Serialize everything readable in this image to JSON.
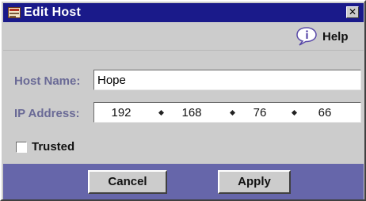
{
  "window": {
    "title": "Edit Host",
    "close_glyph": "✕",
    "app_icon": "dns-host-app-icon"
  },
  "toolbar": {
    "help_label": "Help",
    "help_icon": "info-speech-bubble-icon"
  },
  "form": {
    "host_name_label": "Host Name:",
    "host_name_value": "Hope",
    "ip_address_label": "IP Address:",
    "ip_octets": [
      "192",
      "168",
      "76",
      "66"
    ],
    "trusted_label": "Trusted",
    "trusted_checked": false
  },
  "buttons": {
    "cancel_label": "Cancel",
    "apply_label": "Apply"
  },
  "colors": {
    "title_bar": "#1a1a8a",
    "label_text": "#6a6a96",
    "button_bar": "#6666aa",
    "panel": "#cccccc"
  }
}
